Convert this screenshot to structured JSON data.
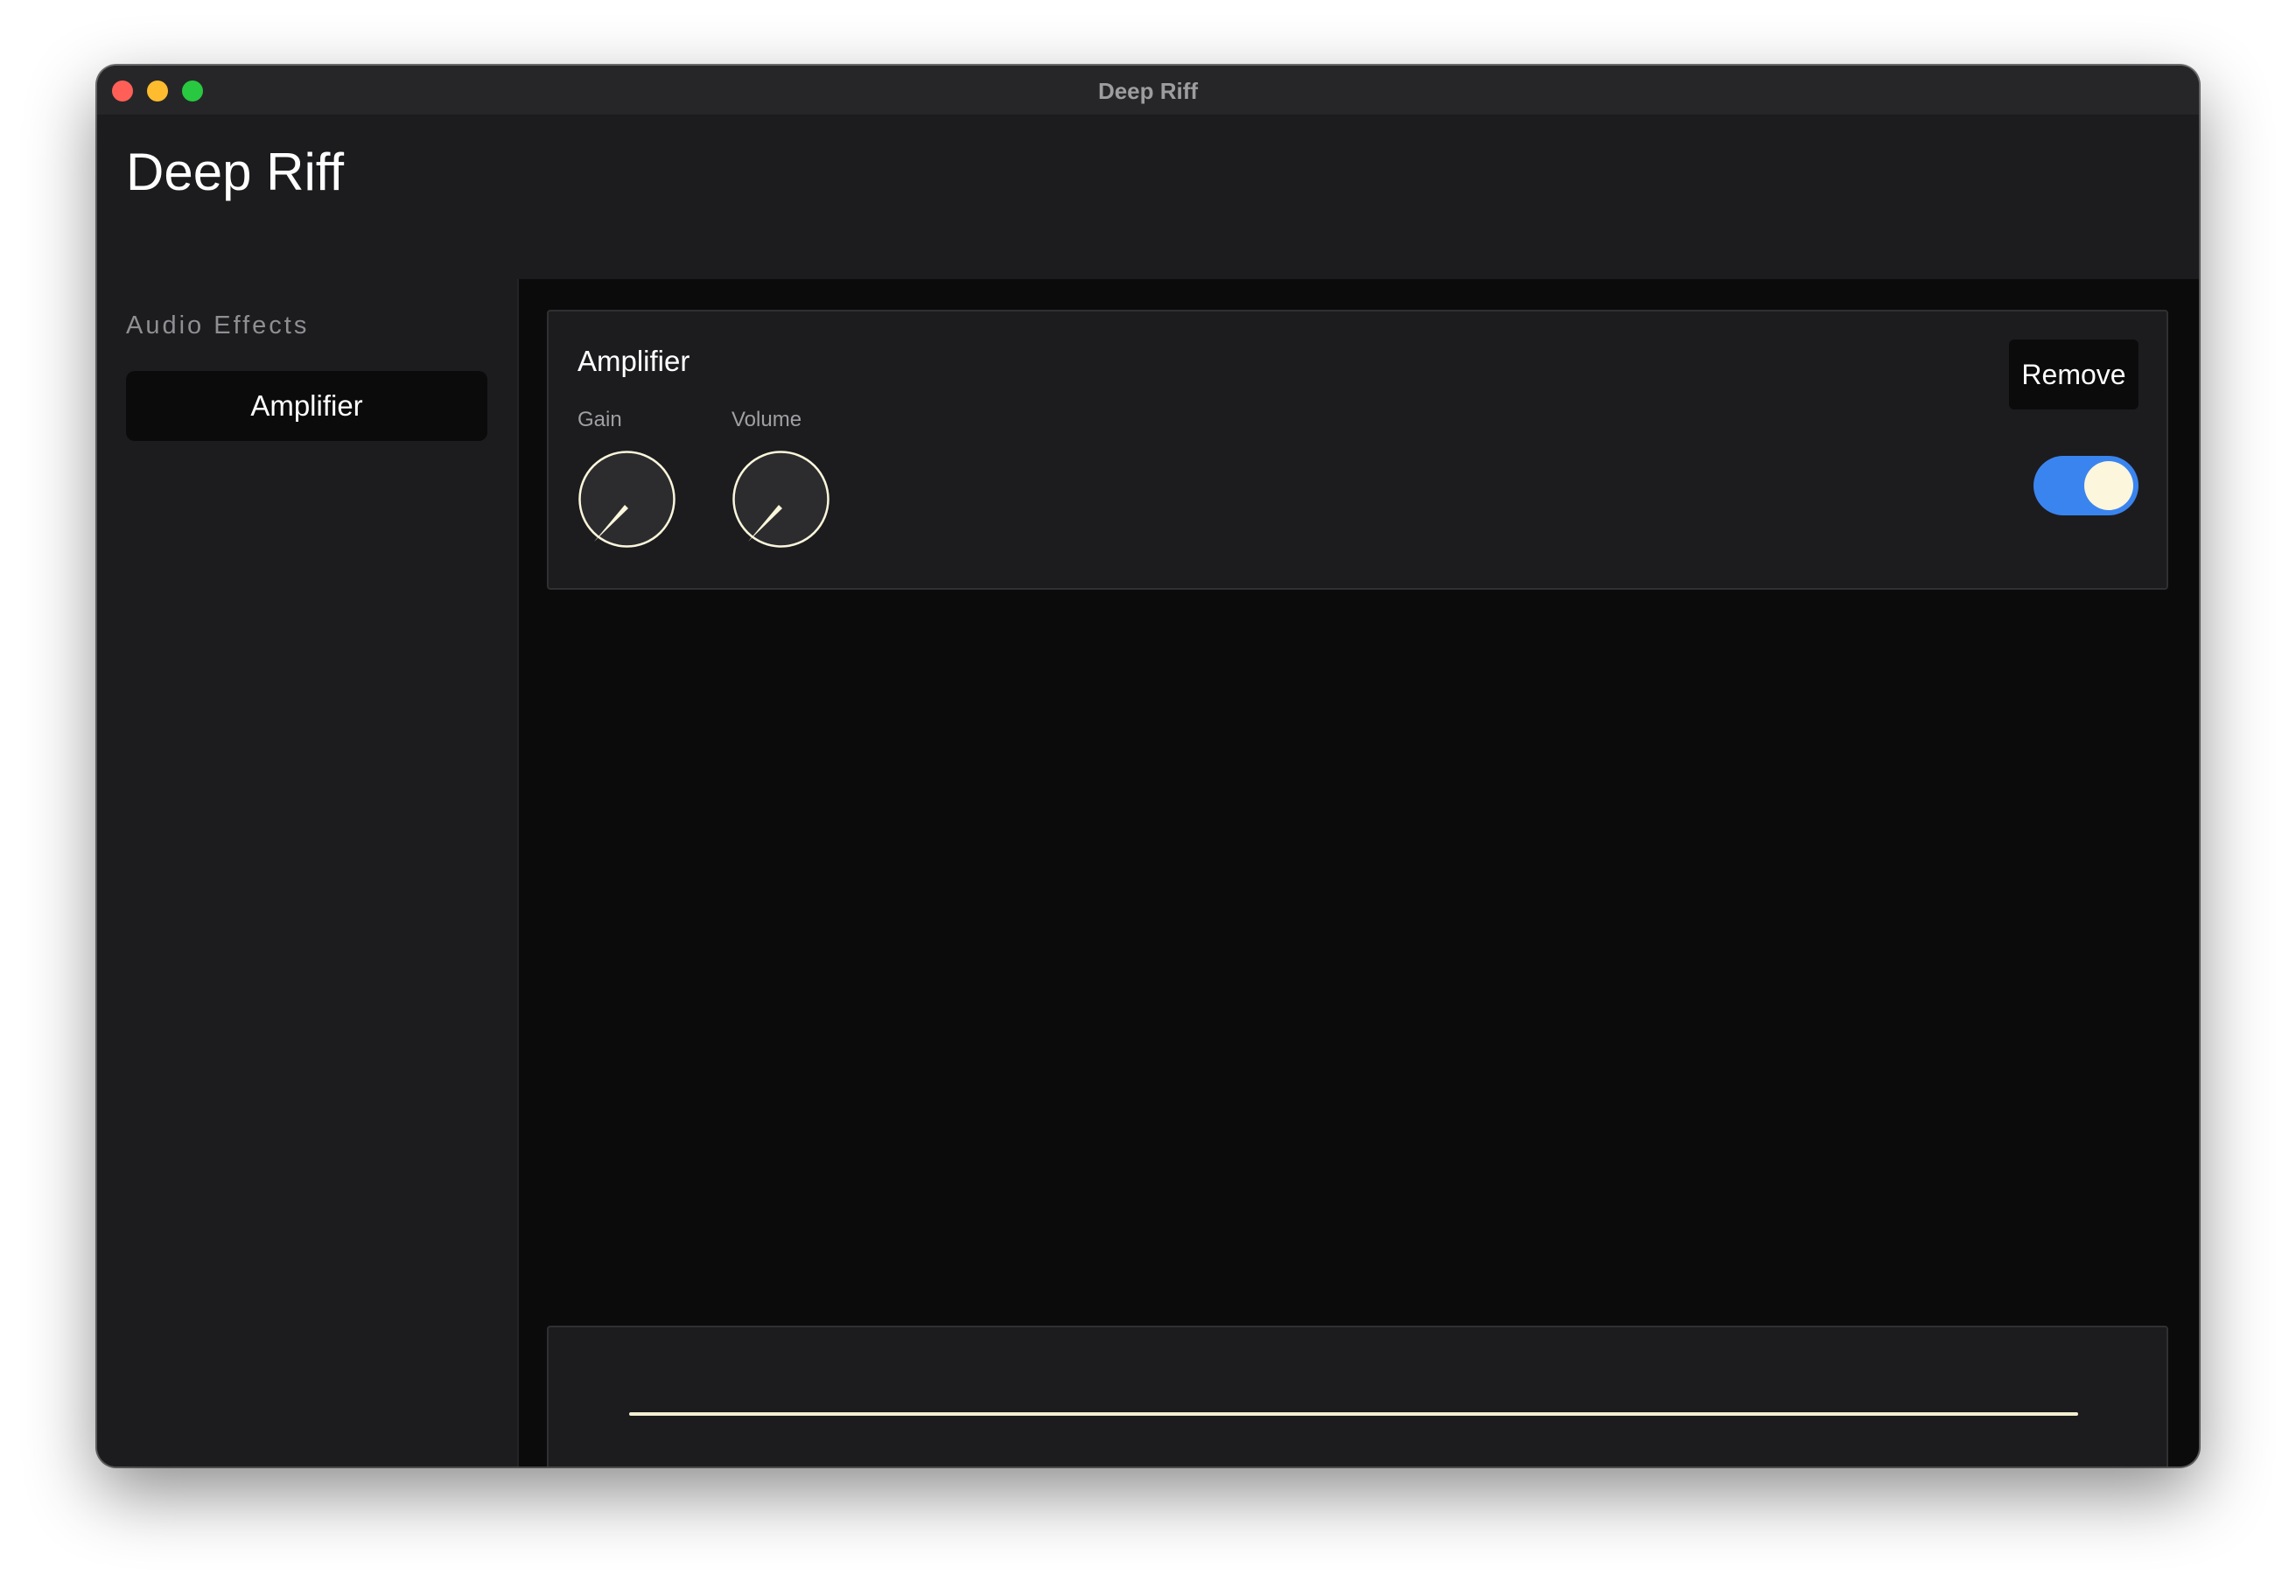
{
  "window": {
    "title": "Deep Riff"
  },
  "header": {
    "title": "Deep Riff"
  },
  "sidebar": {
    "heading": "Audio Effects",
    "items": [
      {
        "label": "Amplifier"
      }
    ]
  },
  "effect": {
    "title": "Amplifier",
    "remove_label": "Remove",
    "enabled": true,
    "knobs": [
      {
        "label": "Gain",
        "value": 0.0
      },
      {
        "label": "Volume",
        "value": 0.0
      }
    ]
  },
  "colors": {
    "toggle_on": "#3a84ef",
    "knob_fill": "#2c2c2e",
    "knob_accent": "#fbf6dc",
    "waveform": "#f4efd3"
  },
  "icons": {
    "knob_indicator": "triangle-pointer-icon"
  }
}
